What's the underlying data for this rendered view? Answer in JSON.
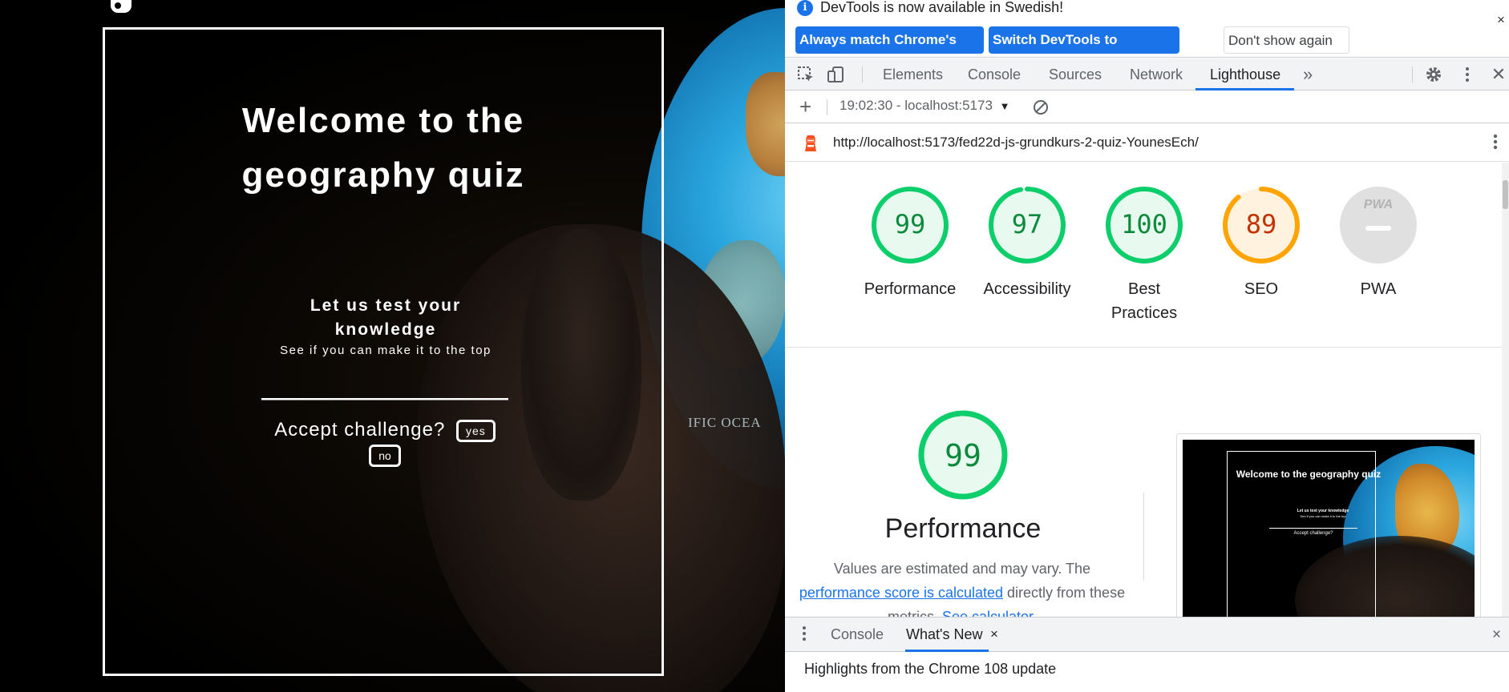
{
  "quiz": {
    "title_line1": "Welcome to the",
    "title_line2": "geography quiz",
    "subtitle_line1": "Let us test your",
    "subtitle_line2": "knowledge",
    "tagline": "See if you can make it to the top",
    "accept_label": "Accept challenge?",
    "yes_button": "yes",
    "no_button": "no",
    "background_text": "IFIC OCEA"
  },
  "devtools": {
    "infobar": {
      "message": "DevTools is now available in Swedish!",
      "match_language_button": "Always match Chrome's language",
      "switch_button": "Switch DevTools to Swedish",
      "dont_show_button": "Don't show again",
      "close_label": "×"
    },
    "tabs": {
      "elements": "Elements",
      "console": "Console",
      "sources": "Sources",
      "network": "Network",
      "lighthouse": "Lighthouse",
      "more": "»"
    },
    "lighthouse_toolbar": {
      "add_label": "+",
      "report_selector": "19:02:30 - localhost:5173",
      "dropdown_arrow": "▼"
    },
    "report_url": "http://localhost:5173/fed22d-js-grundkurs-2-quiz-YounesEch/",
    "scores": [
      {
        "value": "99",
        "label": "Performance",
        "score": 0.99,
        "color": "#0cce6b"
      },
      {
        "value": "97",
        "label": "Accessibility",
        "score": 0.97,
        "color": "#0cce6b"
      },
      {
        "value": "100",
        "label_line1": "Best",
        "label_line2": "Practices",
        "score": 1.0,
        "color": "#0cce6b"
      },
      {
        "value": "89",
        "label": "SEO",
        "score": 0.89,
        "color": "#ffa400"
      }
    ],
    "pwa": {
      "badge": "PWA",
      "label": "PWA"
    },
    "performance_section": {
      "score": "99",
      "heading": "Performance",
      "desc_before": "Values are estimated and may vary. The",
      "link_calc": "performance score is calculated",
      "desc_after": "directly from these",
      "desc_metrics": "metrics.",
      "link_calculator": "See calculator."
    },
    "thumbnail": {
      "title": "Welcome to the geography quiz",
      "sub1": "Let us test your knowledge",
      "sub2": "See if you can make it to the top",
      "accept": "Accept challenge?"
    },
    "drawer": {
      "console_tab": "Console",
      "whats_new_tab": "What's New",
      "tab_close": "×",
      "drawer_close": "×",
      "content": "Highlights from the Chrome 108 update"
    }
  },
  "colors": {
    "pass_green": "#0cce6b",
    "average_orange": "#ffa400",
    "accent_blue": "#1a73e8"
  }
}
